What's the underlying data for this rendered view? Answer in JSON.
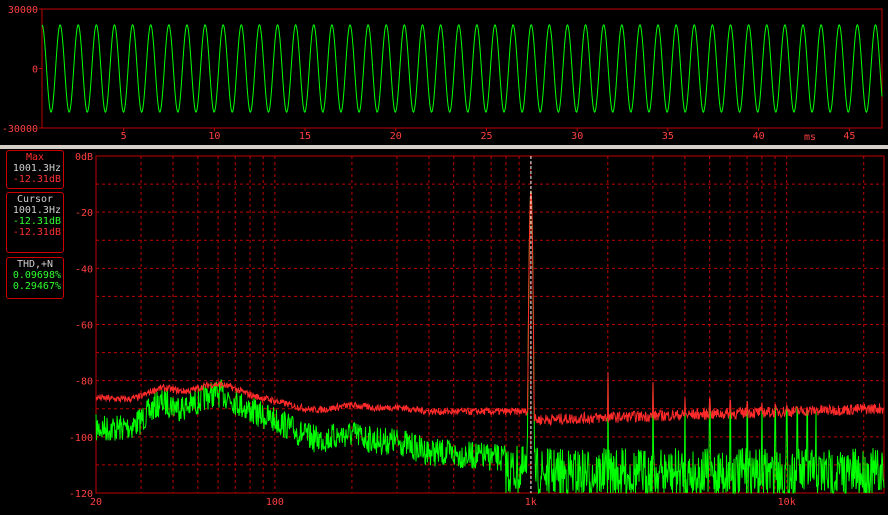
{
  "colors": {
    "waveform": "#00ff00",
    "channel_a": "#ff2a2a",
    "channel_b": "#00ff00",
    "grid": "#c00000",
    "axis_text": "#ff4040",
    "background": "#000000",
    "cursor": "#ffffff"
  },
  "waveform": {
    "y_ticks": [
      "30000",
      "0",
      "-30000"
    ],
    "x_ticks": [
      "5",
      "10",
      "15",
      "20",
      "25",
      "30",
      "35",
      "40",
      "45"
    ],
    "x_unit": "ms",
    "amplitude": 22000,
    "frequency_hz": 1001.3,
    "time_range_ms": [
      0.5,
      46.8
    ]
  },
  "spectrum": {
    "y_ticks": [
      "0dB",
      "-20",
      "-40",
      "-60",
      "-80",
      "-100",
      "-120"
    ],
    "x_ticks": [
      "20",
      "100",
      "1k",
      "10k"
    ],
    "peak_frequency_hz": 1001.3,
    "peak_level_db": -12.31,
    "y_range_db": [
      -120,
      0
    ],
    "x_range_hz": [
      20,
      24000
    ],
    "x_scale": "log"
  },
  "readout": {
    "max": {
      "title": "Max",
      "frequency": "1001.3Hz",
      "level": "-12.31dB"
    },
    "cursor": {
      "title": "Cursor",
      "frequency": "1001.3Hz",
      "level_a": "-12.31dB",
      "level_b": "-12.31dB"
    },
    "thd": {
      "title": "THD,+N",
      "thd": "0.09698%",
      "thd_n": "0.29467%"
    }
  }
}
